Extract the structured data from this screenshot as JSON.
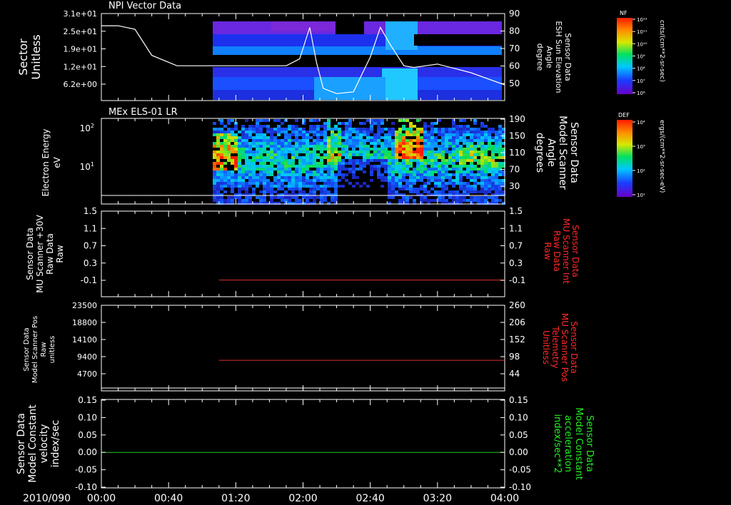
{
  "date_label": "2010/090",
  "time_ticks": [
    "00:00",
    "00:40",
    "01:20",
    "02:00",
    "02:40",
    "03:20",
    "04:00"
  ],
  "colorbars": [
    {
      "label": "NF",
      "unit": "cnts/(cm**2-sr-sec)",
      "ticks": [
        "10¹²",
        "10¹¹",
        "10¹⁰",
        "10⁹",
        "10⁸",
        "10⁷",
        "10⁶"
      ]
    },
    {
      "label": "DEF",
      "unit": "ergs/(cm**2-sr-sec-eV)",
      "ticks": [
        "10⁴",
        "10³",
        "10²",
        "10¹"
      ]
    }
  ],
  "chart_data": [
    {
      "type": "heatmap",
      "title": "NPI Vector Data",
      "ylabel": "Sector\nUnitless",
      "yticks": [
        "3.1e+01",
        "2.5e+01",
        "1.9e+01",
        "1.2e+01",
        "6.2e+00"
      ],
      "y2label": "Sensor Data\nESH Sun Elevation\nAngle\ndegree",
      "y2ticks": [
        "90",
        "80",
        "70",
        "60",
        "50"
      ],
      "ylim2": [
        40,
        90
      ],
      "overlay_line": {
        "x": [
          "00:00",
          "00:10",
          "00:20",
          "00:30",
          "00:45",
          "01:40",
          "01:50",
          "01:58",
          "02:04",
          "02:08",
          "02:12",
          "02:20",
          "02:30",
          "02:40",
          "02:46",
          "02:52",
          "03:00",
          "03:06",
          "03:20",
          "03:40",
          "04:00"
        ],
        "y": [
          83,
          83,
          81,
          66,
          60,
          60,
          60,
          64,
          82,
          62,
          47,
          44,
          45,
          65,
          82,
          72,
          60,
          59,
          61,
          56,
          49
        ]
      }
    },
    {
      "type": "heatmap",
      "title": "MEx ELS-01 LR",
      "ylabel": "Electron Energy\neV",
      "yticks": [
        "10²",
        "10¹"
      ],
      "y2label": "Sensor Data\nModel Scanner\nAngle\ndegrees",
      "y2ticks": [
        "190",
        "150",
        "110",
        "70",
        "30"
      ],
      "ylim2": [
        0,
        190
      ]
    },
    {
      "type": "line",
      "ylabel": "Sensor Data\nMU Scanner +30V\nRaw Data\nRaw",
      "yticks": [
        "1.5",
        "1.1",
        "0.7",
        "0.3",
        "-0.1"
      ],
      "ylim": [
        -0.3,
        1.5
      ],
      "y2label": "Sensor Data\nMU Scanner Int\nRaw Data\nRaw",
      "y2ticks": [
        "1.5",
        "1.1",
        "0.7",
        "0.3",
        "-0.1"
      ],
      "series": [
        {
          "x": [
            "01:10",
            "04:00"
          ],
          "y": [
            0.05,
            0.05
          ]
        }
      ]
    },
    {
      "type": "line",
      "ylabel": "Sensor Data\nModel Scanner Pos\nRaw\nunitless",
      "yticks": [
        "23500",
        "18800",
        "14100",
        "9400",
        "4700"
      ],
      "y2label": "Sensor Data\nMU Scanner Pos\nTelemetry\nUnitless",
      "y2ticks": [
        "260",
        "206",
        "152",
        "98",
        "44"
      ],
      "ylim2": [
        0,
        260
      ],
      "series": [
        {
          "x": [
            "01:10",
            "04:00"
          ],
          "y": [
            93,
            93
          ]
        }
      ]
    },
    {
      "type": "line",
      "ylabel": "Sensor Data\nModel Constant\nvelocity\nindex/sec",
      "yticks": [
        "0.15",
        "0.10",
        "0.05",
        "0.00",
        "-0.05",
        "-0.10"
      ],
      "ylim": [
        -0.1,
        0.15
      ],
      "y2label": "Sensor Data\nModel Constant\nacceleration\nindex/sec**2",
      "y2ticks": [
        "0.15",
        "0.10",
        "0.05",
        "0.00",
        "-0.05",
        "-0.10"
      ],
      "series": [
        {
          "x": [
            "00:00",
            "04:00"
          ],
          "y": [
            0.0,
            0.0
          ]
        }
      ]
    }
  ],
  "colors": {
    "white": "#ffffff",
    "red_label": "#ff2a2a",
    "green_label": "#22ee22",
    "red_line": "#e03030",
    "green_line": "#22cc22"
  }
}
